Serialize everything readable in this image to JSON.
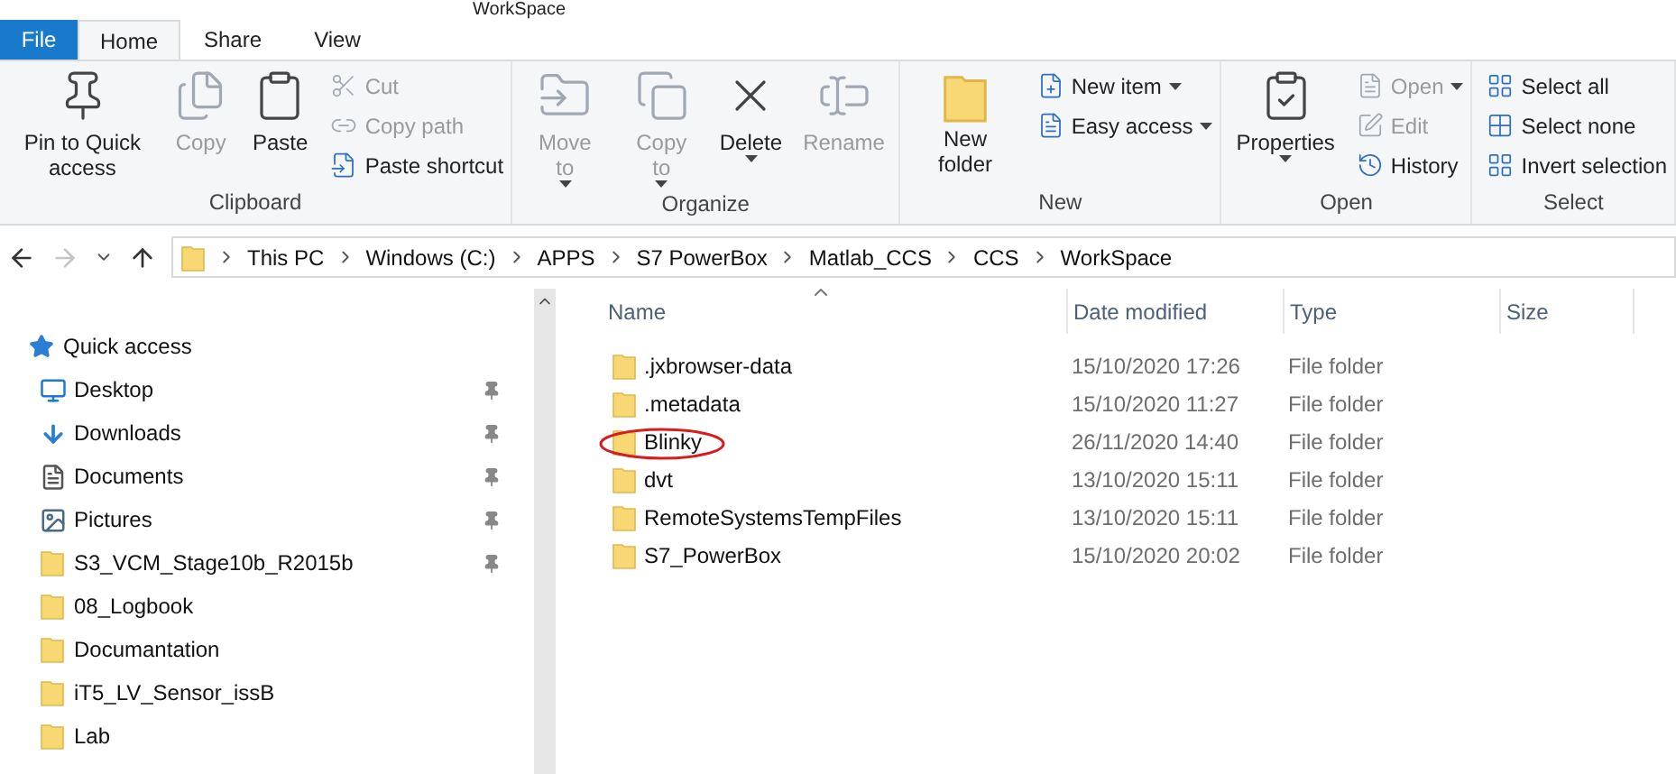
{
  "window": {
    "title": "WorkSpace"
  },
  "tabs": [
    {
      "label": "File",
      "kind": "file"
    },
    {
      "label": "Home",
      "kind": "tab",
      "selected": true
    },
    {
      "label": "Share",
      "kind": "tab",
      "selected": false
    },
    {
      "label": "View",
      "kind": "tab",
      "selected": false
    }
  ],
  "ribbon": {
    "groups": [
      {
        "label": "Clipboard",
        "items": [
          {
            "kind": "large",
            "label": "Pin to Quick access",
            "disabled": false,
            "menu": false
          },
          {
            "kind": "large",
            "label": "Copy",
            "disabled": true,
            "menu": false
          },
          {
            "kind": "large",
            "label": "Paste",
            "disabled": false,
            "menu": false
          },
          {
            "kind": "small",
            "label": "Cut",
            "disabled": true,
            "menu": false
          },
          {
            "kind": "small",
            "label": "Copy path",
            "disabled": true,
            "menu": false
          },
          {
            "kind": "small",
            "label": "Paste shortcut",
            "disabled": false,
            "menu": false
          }
        ]
      },
      {
        "label": "Organize",
        "items": [
          {
            "kind": "large",
            "label": "Move to",
            "disabled": true,
            "menu": true
          },
          {
            "kind": "large",
            "label": "Copy to",
            "disabled": true,
            "menu": true
          },
          {
            "kind": "large",
            "label": "Delete",
            "disabled": false,
            "menu": true
          },
          {
            "kind": "large",
            "label": "Rename",
            "disabled": true,
            "menu": false
          }
        ]
      },
      {
        "label": "New",
        "items": [
          {
            "kind": "large",
            "label": "New folder",
            "disabled": false,
            "menu": false
          },
          {
            "kind": "small",
            "label": "New item",
            "disabled": false,
            "menu": true
          },
          {
            "kind": "small",
            "label": "Easy access",
            "disabled": false,
            "menu": true
          }
        ]
      },
      {
        "label": "Open",
        "items": [
          {
            "kind": "large",
            "label": "Properties",
            "disabled": false,
            "menu": true
          },
          {
            "kind": "small",
            "label": "Open",
            "disabled": true,
            "menu": true
          },
          {
            "kind": "small",
            "label": "Edit",
            "disabled": true,
            "menu": false
          },
          {
            "kind": "small",
            "label": "History",
            "disabled": false,
            "menu": false
          }
        ]
      },
      {
        "label": "Select",
        "items": [
          {
            "kind": "small",
            "label": "Select all",
            "disabled": false,
            "menu": false
          },
          {
            "kind": "small",
            "label": "Select none",
            "disabled": false,
            "menu": false
          },
          {
            "kind": "small",
            "label": "Invert selection",
            "disabled": false,
            "menu": false
          }
        ]
      }
    ]
  },
  "address": {
    "segments": [
      "This PC",
      "Windows (C:)",
      "APPS",
      "S7 PowerBox",
      "Matlab_CCS",
      "CCS",
      "WorkSpace"
    ]
  },
  "sidebar": {
    "items": [
      {
        "label": "Quick access",
        "kind": "quick",
        "children": [
          {
            "label": "Desktop",
            "kind": "desktop",
            "pinned": true
          },
          {
            "label": "Downloads",
            "kind": "downloads",
            "pinned": true
          },
          {
            "label": "Documents",
            "kind": "documents",
            "pinned": true
          },
          {
            "label": "Pictures",
            "kind": "pictures",
            "pinned": true
          },
          {
            "label": "S3_VCM_Stage10b_R2015b",
            "kind": "folder",
            "pinned": true
          },
          {
            "label": "08_Logbook",
            "kind": "folder",
            "pinned": false
          },
          {
            "label": "Documantation",
            "kind": "folder",
            "pinned": false
          },
          {
            "label": "iT5_LV_Sensor_issB",
            "kind": "folder",
            "pinned": false
          },
          {
            "label": "Lab",
            "kind": "folder",
            "pinned": false
          }
        ]
      }
    ]
  },
  "table": {
    "columns": [
      {
        "label": "Name",
        "sorted": true
      },
      {
        "label": "Date modified",
        "sorted": false
      },
      {
        "label": "Type",
        "sorted": false
      },
      {
        "label": "Size",
        "sorted": false
      }
    ],
    "rows": [
      {
        "name": ".jxbrowser-data",
        "date": "15/10/2020 17:26",
        "type": "File folder",
        "circled": false
      },
      {
        "name": ".metadata",
        "date": "15/10/2020 11:27",
        "type": "File folder",
        "circled": false
      },
      {
        "name": "Blinky",
        "date": "26/11/2020 14:40",
        "type": "File folder",
        "circled": true
      },
      {
        "name": "dvt",
        "date": "13/10/2020 15:11",
        "type": "File folder",
        "circled": false
      },
      {
        "name": "RemoteSystemsTempFiles",
        "date": "13/10/2020 15:11",
        "type": "File folder",
        "circled": false
      },
      {
        "name": "S7_PowerBox",
        "date": "15/10/2020 20:02",
        "type": "File folder",
        "circled": false
      }
    ]
  }
}
